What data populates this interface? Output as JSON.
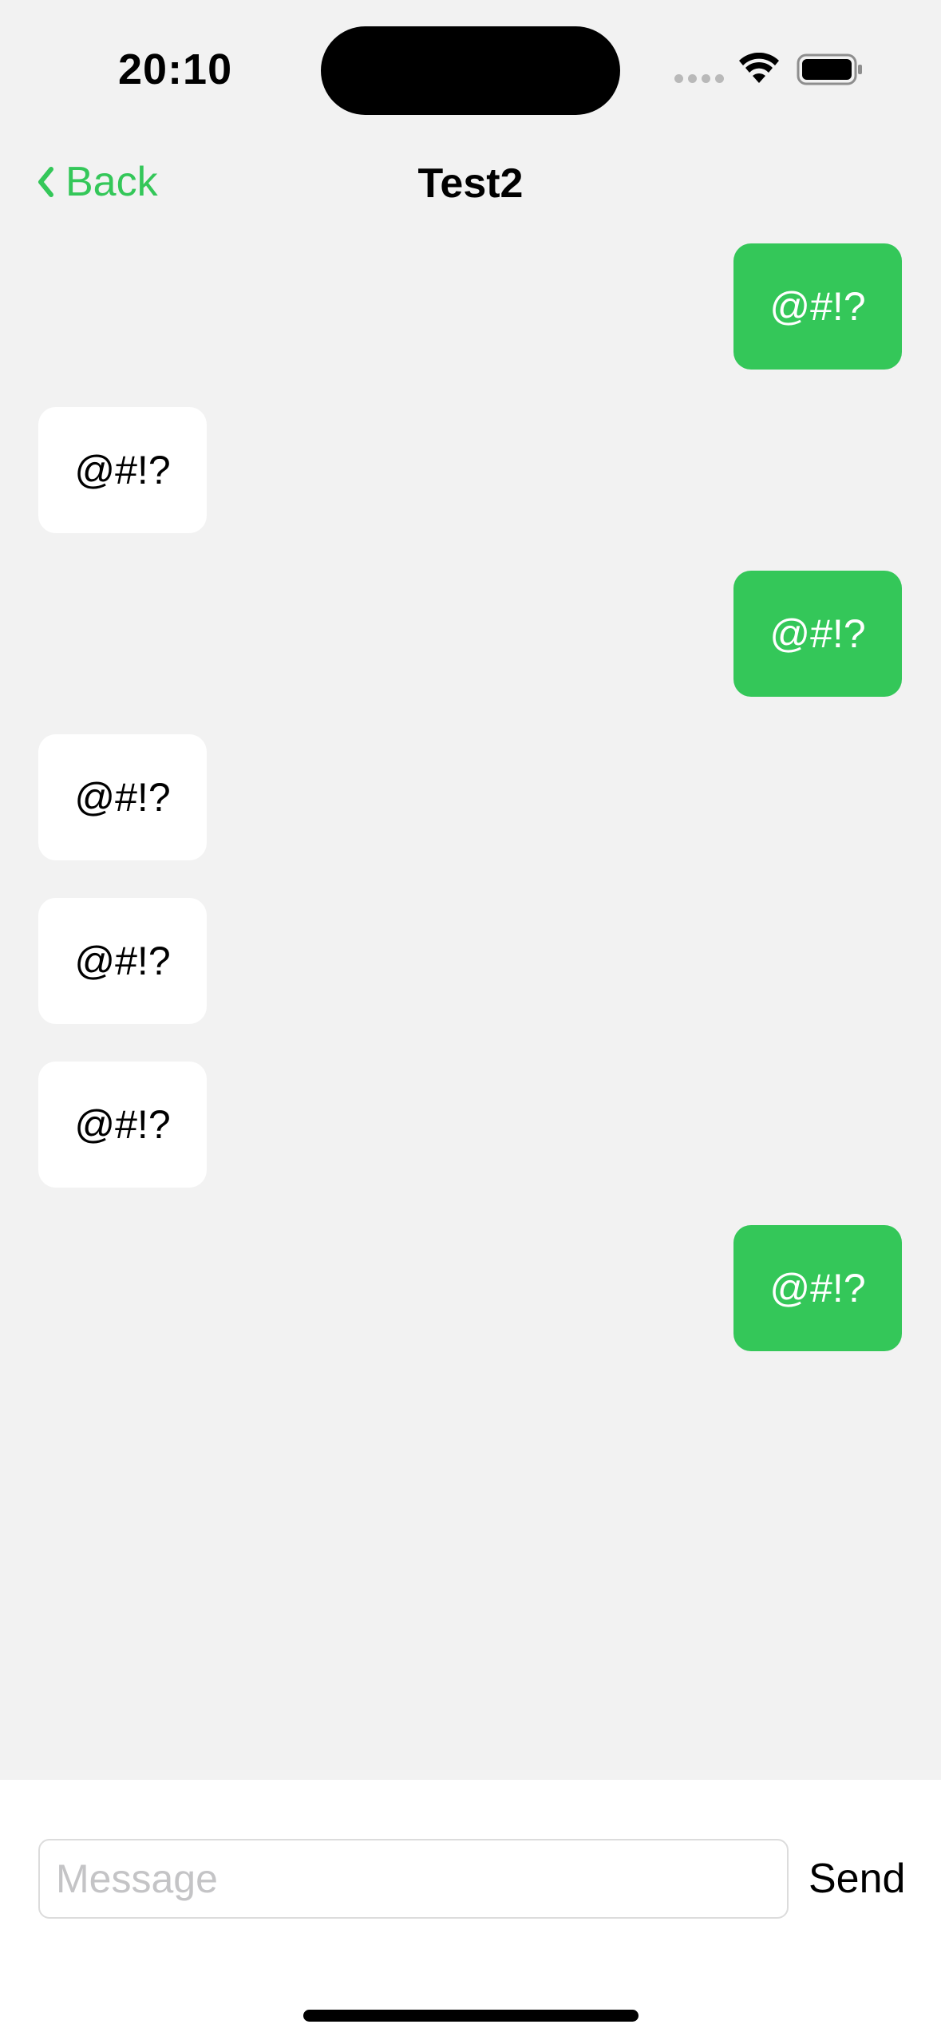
{
  "status_bar": {
    "time": "20:10"
  },
  "nav": {
    "back_label": "Back",
    "title": "Test2"
  },
  "messages": [
    {
      "direction": "outgoing",
      "text": "@#!?"
    },
    {
      "direction": "incoming",
      "text": "@#!?"
    },
    {
      "direction": "outgoing",
      "text": "@#!?"
    },
    {
      "direction": "incoming",
      "text": "@#!?"
    },
    {
      "direction": "incoming",
      "text": "@#!?"
    },
    {
      "direction": "incoming",
      "text": "@#!?"
    },
    {
      "direction": "outgoing",
      "text": "@#!?"
    }
  ],
  "composer": {
    "value": "",
    "placeholder": "Message",
    "send_label": "Send"
  },
  "colors": {
    "accent": "#34c759",
    "background": "#f2f2f2",
    "incoming_bubble": "#ffffff",
    "outgoing_text": "#ffffff"
  },
  "icons": {
    "back": "chevron-left-icon",
    "wifi": "wifi-icon",
    "battery": "battery-icon",
    "signal": "cellular-signal-icon"
  }
}
